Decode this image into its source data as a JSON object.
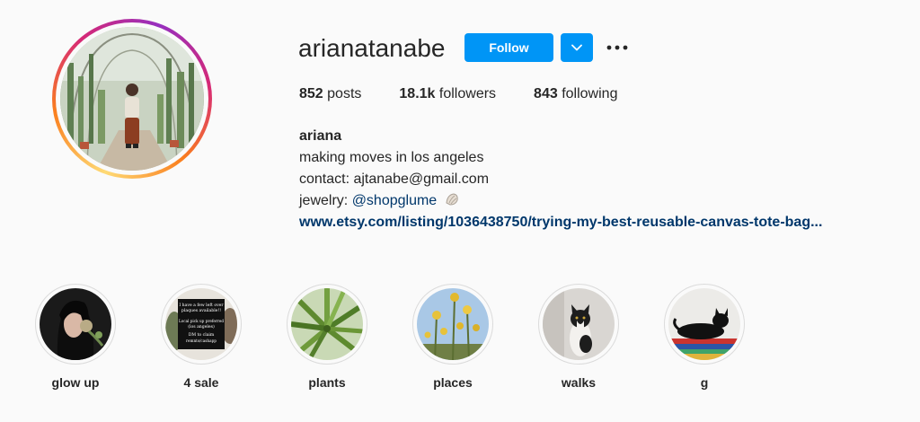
{
  "profile": {
    "username": "arianatanabe",
    "follow_label": "Follow",
    "stats": {
      "posts_count": "852",
      "posts_label": "posts",
      "followers_count": "18.1k",
      "followers_label": "followers",
      "following_count": "843",
      "following_label": "following"
    },
    "bio": {
      "name": "ariana",
      "line1": "making moves in los angeles",
      "line2": "contact: ajtanabe@gmail.com",
      "jewelry_prefix": "jewelry: ",
      "jewelry_handle": "@shopglume",
      "link": "www.etsy.com/listing/1036438750/trying-my-best-reusable-canvas-tote-bag..."
    }
  },
  "highlights": [
    {
      "label": "glow up"
    },
    {
      "label": "4 sale",
      "image_text": [
        "I have a few left over",
        "plaques available!!",
        "Local pick up preferred",
        "(los angeles)",
        "DM to claim",
        "remnts/cashapp"
      ]
    },
    {
      "label": "plants"
    },
    {
      "label": "places"
    },
    {
      "label": "walks"
    },
    {
      "label": "g"
    }
  ],
  "colors": {
    "primary_button": "#0095f6",
    "link": "#00376b",
    "text": "#262626",
    "background": "#fafafa"
  }
}
